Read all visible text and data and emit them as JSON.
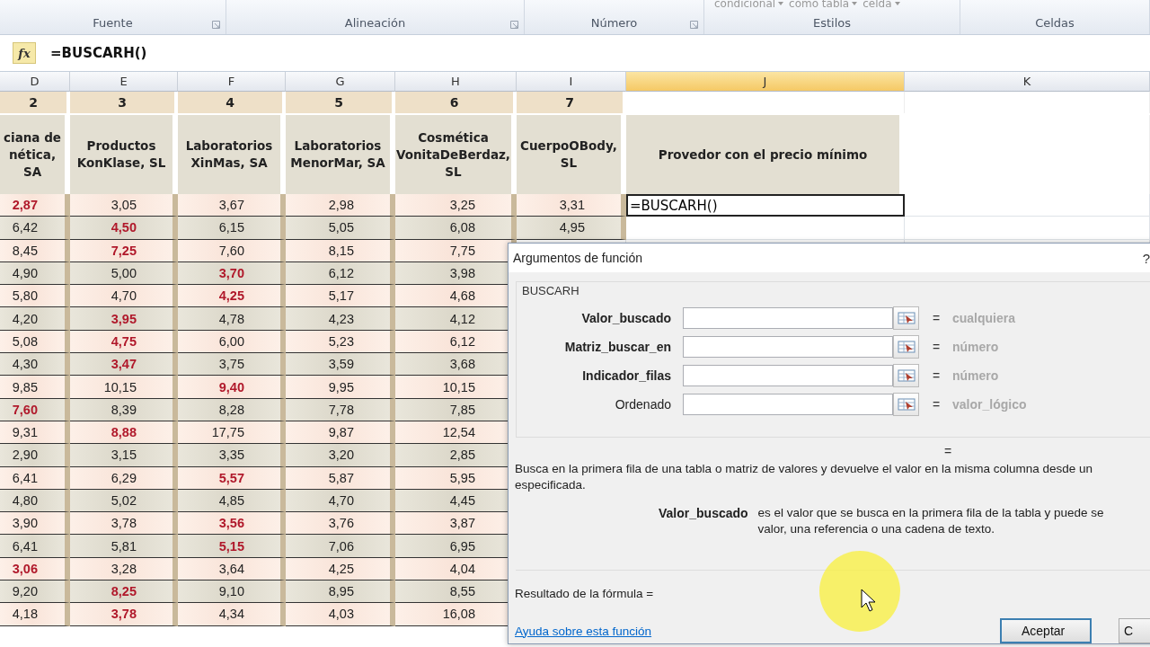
{
  "ribbon": {
    "style_buttons": [
      {
        "label": "condicional"
      },
      {
        "label": "como tabla"
      },
      {
        "label": "celda"
      }
    ],
    "groups": [
      {
        "label": "Fuente",
        "launcher": true
      },
      {
        "label": "Alineación",
        "launcher": true
      },
      {
        "label": "Número",
        "launcher": true
      },
      {
        "label": "Estilos",
        "launcher": false
      },
      {
        "label": "Celdas",
        "launcher": false
      }
    ]
  },
  "formula_bar": {
    "fx": "fx",
    "formula": "=BUSCARH()"
  },
  "columns": [
    {
      "letter": "D",
      "selected": false
    },
    {
      "letter": "E",
      "selected": false
    },
    {
      "letter": "F",
      "selected": false
    },
    {
      "letter": "G",
      "selected": false
    },
    {
      "letter": "H",
      "selected": false
    },
    {
      "letter": "I",
      "selected": false
    },
    {
      "letter": "J",
      "selected": true
    },
    {
      "letter": "K",
      "selected": false
    }
  ],
  "table": {
    "numbers": [
      "2",
      "3",
      "4",
      "5",
      "6",
      "7"
    ],
    "headers": [
      "ciana de\nnética, SA",
      "Productos\nKonKlase, SL",
      "Laboratorios\nXinMas, SA",
      "Laboratorios\nMenorMar, SA",
      "Cosmética\nVonitaDeBerdaz,\nSL",
      "CuerpoOBody,\nSL",
      "Provedor con el precio mínimo"
    ],
    "active_cell": {
      "value": "=BUSCARH()"
    },
    "rows": [
      {
        "cells": [
          {
            "value": "2,87",
            "lowest": true
          },
          {
            "value": "3,05",
            "lowest": false
          },
          {
            "value": "3,67",
            "lowest": false
          },
          {
            "value": "2,98",
            "lowest": false
          },
          {
            "value": "3,25",
            "lowest": false
          },
          {
            "value": "3,31",
            "lowest": false
          }
        ]
      },
      {
        "cells": [
          {
            "value": "6,42",
            "lowest": false
          },
          {
            "value": "4,50",
            "lowest": true
          },
          {
            "value": "6,15",
            "lowest": false
          },
          {
            "value": "5,05",
            "lowest": false
          },
          {
            "value": "6,08",
            "lowest": false
          },
          {
            "value": "4,95",
            "lowest": false
          }
        ]
      },
      {
        "cells": [
          {
            "value": "8,45",
            "lowest": false
          },
          {
            "value": "7,25",
            "lowest": true
          },
          {
            "value": "7,60",
            "lowest": false
          },
          {
            "value": "8,15",
            "lowest": false
          },
          {
            "value": "7,75",
            "lowest": false
          }
        ]
      },
      {
        "cells": [
          {
            "value": "4,90",
            "lowest": false
          },
          {
            "value": "5,00",
            "lowest": false
          },
          {
            "value": "3,70",
            "lowest": true
          },
          {
            "value": "6,12",
            "lowest": false
          },
          {
            "value": "3,98",
            "lowest": false
          }
        ]
      },
      {
        "cells": [
          {
            "value": "5,80",
            "lowest": false
          },
          {
            "value": "4,70",
            "lowest": false
          },
          {
            "value": "4,25",
            "lowest": true
          },
          {
            "value": "5,17",
            "lowest": false
          },
          {
            "value": "4,68",
            "lowest": false
          }
        ]
      },
      {
        "cells": [
          {
            "value": "4,20",
            "lowest": false
          },
          {
            "value": "3,95",
            "lowest": true
          },
          {
            "value": "4,78",
            "lowest": false
          },
          {
            "value": "4,23",
            "lowest": false
          },
          {
            "value": "4,12",
            "lowest": false
          }
        ]
      },
      {
        "cells": [
          {
            "value": "5,08",
            "lowest": false
          },
          {
            "value": "4,75",
            "lowest": true
          },
          {
            "value": "6,00",
            "lowest": false
          },
          {
            "value": "5,23",
            "lowest": false
          },
          {
            "value": "6,12",
            "lowest": false
          }
        ]
      },
      {
        "cells": [
          {
            "value": "4,30",
            "lowest": false
          },
          {
            "value": "3,47",
            "lowest": true
          },
          {
            "value": "3,75",
            "lowest": false
          },
          {
            "value": "3,59",
            "lowest": false
          },
          {
            "value": "3,68",
            "lowest": false
          }
        ]
      },
      {
        "cells": [
          {
            "value": "9,85",
            "lowest": false
          },
          {
            "value": "10,15",
            "lowest": false
          },
          {
            "value": "9,40",
            "lowest": true
          },
          {
            "value": "9,95",
            "lowest": false
          },
          {
            "value": "10,15",
            "lowest": false
          }
        ]
      },
      {
        "cells": [
          {
            "value": "7,60",
            "lowest": true
          },
          {
            "value": "8,39",
            "lowest": false
          },
          {
            "value": "8,28",
            "lowest": false
          },
          {
            "value": "7,78",
            "lowest": false
          },
          {
            "value": "7,85",
            "lowest": false
          }
        ]
      },
      {
        "cells": [
          {
            "value": "9,31",
            "lowest": false
          },
          {
            "value": "8,88",
            "lowest": true
          },
          {
            "value": "17,75",
            "lowest": false
          },
          {
            "value": "9,87",
            "lowest": false
          },
          {
            "value": "12,54",
            "lowest": false
          }
        ]
      },
      {
        "cells": [
          {
            "value": "2,90",
            "lowest": false
          },
          {
            "value": "3,15",
            "lowest": false
          },
          {
            "value": "3,35",
            "lowest": false
          },
          {
            "value": "3,20",
            "lowest": false
          },
          {
            "value": "2,85",
            "lowest": false
          }
        ]
      },
      {
        "cells": [
          {
            "value": "6,41",
            "lowest": false
          },
          {
            "value": "6,29",
            "lowest": false
          },
          {
            "value": "5,57",
            "lowest": true
          },
          {
            "value": "5,87",
            "lowest": false
          },
          {
            "value": "5,95",
            "lowest": false
          }
        ]
      },
      {
        "cells": [
          {
            "value": "4,80",
            "lowest": false
          },
          {
            "value": "5,02",
            "lowest": false
          },
          {
            "value": "4,85",
            "lowest": false
          },
          {
            "value": "4,70",
            "lowest": false
          },
          {
            "value": "4,45",
            "lowest": false
          }
        ]
      },
      {
        "cells": [
          {
            "value": "3,90",
            "lowest": false
          },
          {
            "value": "3,78",
            "lowest": false
          },
          {
            "value": "3,56",
            "lowest": true
          },
          {
            "value": "3,76",
            "lowest": false
          },
          {
            "value": "3,87",
            "lowest": false
          }
        ]
      },
      {
        "cells": [
          {
            "value": "6,41",
            "lowest": false
          },
          {
            "value": "5,81",
            "lowest": false
          },
          {
            "value": "5,15",
            "lowest": true
          },
          {
            "value": "7,06",
            "lowest": false
          },
          {
            "value": "6,95",
            "lowest": false
          }
        ]
      },
      {
        "cells": [
          {
            "value": "3,06",
            "lowest": true
          },
          {
            "value": "3,28",
            "lowest": false
          },
          {
            "value": "3,64",
            "lowest": false
          },
          {
            "value": "4,25",
            "lowest": false
          },
          {
            "value": "4,04",
            "lowest": false
          }
        ]
      },
      {
        "cells": [
          {
            "value": "9,20",
            "lowest": false
          },
          {
            "value": "8,25",
            "lowest": true
          },
          {
            "value": "9,10",
            "lowest": false
          },
          {
            "value": "8,95",
            "lowest": false
          },
          {
            "value": "8,55",
            "lowest": false
          }
        ]
      },
      {
        "cells": [
          {
            "value": "4,18",
            "lowest": false
          },
          {
            "value": "3,78",
            "lowest": true
          },
          {
            "value": "4,34",
            "lowest": false
          },
          {
            "value": "4,03",
            "lowest": false
          },
          {
            "value": "16,08",
            "lowest": false
          }
        ]
      }
    ]
  },
  "dialog": {
    "title": "Argumentos de función",
    "help": "?",
    "function": "BUSCARH",
    "arguments": [
      {
        "name": "Valor_buscado",
        "required": true,
        "hint": "cualquiera"
      },
      {
        "name": "Matriz_buscar_en",
        "required": true,
        "hint": "número"
      },
      {
        "name": "Indicador_filas",
        "required": true,
        "hint": "número"
      },
      {
        "name": "Ordenado",
        "required": false,
        "hint": "valor_lógico"
      }
    ],
    "equals": "=",
    "result_equals": "=",
    "description": [
      "Busca en la primera fila de una tabla o matriz de valores y devuelve el valor en la misma columna desde un",
      "especificada."
    ],
    "argument_help": {
      "name": "Valor_buscado",
      "lines": [
        "es el valor que se busca en la primera fila de la tabla y puede se",
        "valor, una referencia o una cadena de texto."
      ]
    },
    "result_label": "Resultado de la fórmula =",
    "help_link": "Ayuda sobre esta función",
    "buttons": [
      {
        "label": "Aceptar",
        "default": true
      },
      {
        "label": "C",
        "default": false
      }
    ]
  }
}
